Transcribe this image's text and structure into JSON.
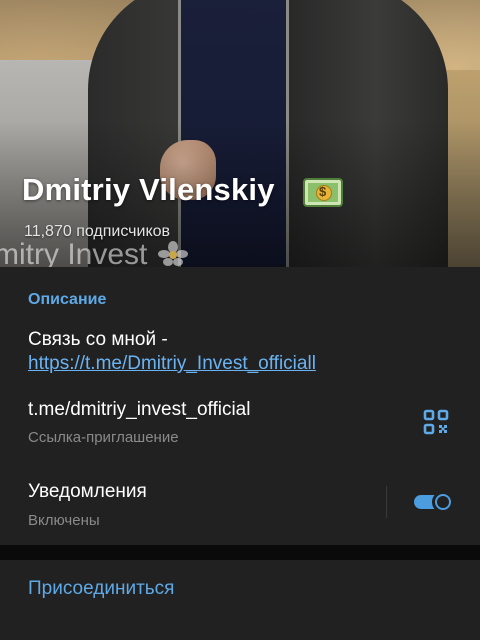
{
  "channel": {
    "title": "Dmitriy Vilenskiy",
    "title_emoji_icon": "money-bag-icon",
    "subscribers": "11,870 подписчиков",
    "watermark": "mitry Invest"
  },
  "description": {
    "section_label": "Описание",
    "text": "Связь со мной -",
    "link": "https://t.me/Dmitriy_Invest_officiall"
  },
  "invite_link": {
    "value": "t.me/dmitriy_invest_official",
    "caption": "Ссылка-приглашение",
    "icon": "qr-code-icon"
  },
  "notifications": {
    "label": "Уведомления",
    "status": "Включены",
    "enabled": true
  },
  "footer": {
    "join_label": "Присоединиться"
  },
  "colors": {
    "accent": "#5ea9e6",
    "link": "#6ab3f3",
    "card_bg": "#212121",
    "toggle": "#4b9de0"
  }
}
